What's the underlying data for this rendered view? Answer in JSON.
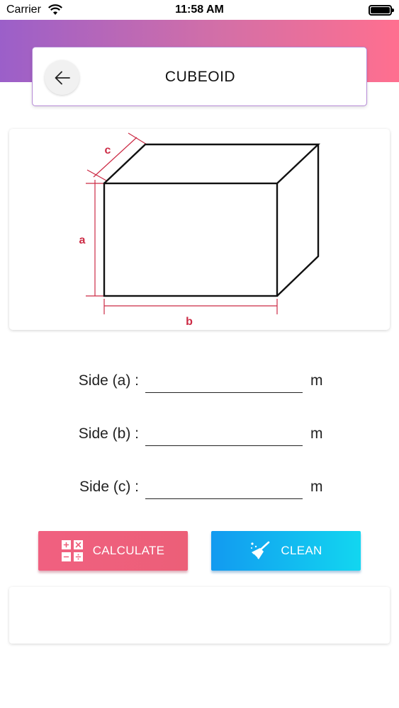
{
  "status_bar": {
    "carrier": "Carrier",
    "time": "11:58 AM"
  },
  "header": {
    "title": "CUBEOID",
    "back_icon": "arrow-left-icon"
  },
  "diagram": {
    "labels": {
      "a": "a",
      "b": "b",
      "c": "c"
    },
    "dimension_color": "#cc2b45"
  },
  "form": {
    "fields": [
      {
        "label": "Side (a) :",
        "value": "",
        "unit": "m"
      },
      {
        "label": "Side (b) :",
        "value": "",
        "unit": "m"
      },
      {
        "label": "Side (c) :",
        "value": "",
        "unit": "m"
      }
    ]
  },
  "buttons": {
    "calculate": {
      "label": "CALCULATE",
      "icon": "calculator-icon",
      "color": "#ef5f7b"
    },
    "clean": {
      "label": "CLEAN",
      "icon": "broom-icon",
      "color": "#12b4f0"
    }
  },
  "result": {
    "text": ""
  },
  "theme": {
    "gradient_start": "#9b5fc9",
    "gradient_end": "#ff6f8f"
  }
}
